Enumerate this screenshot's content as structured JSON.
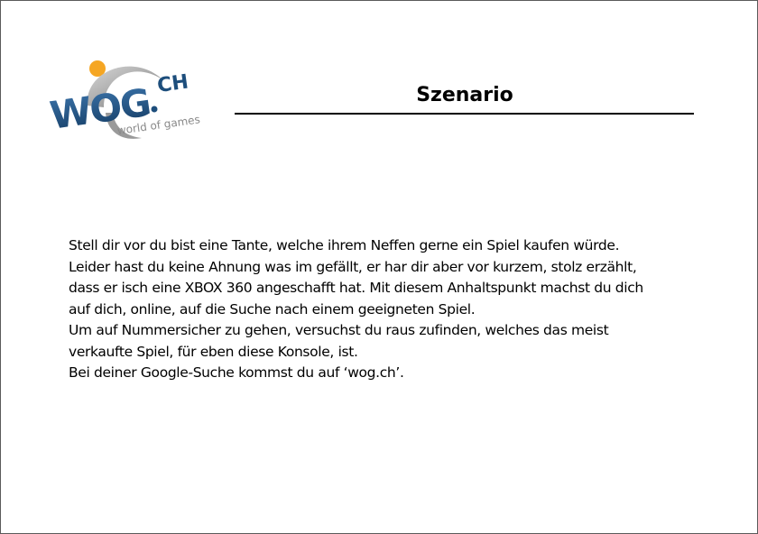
{
  "logo": {
    "primary_text": "WOG",
    "suffix_text": "CH",
    "tagline": "world of games",
    "colors": {
      "blue": "#1d4e7c",
      "gray": "#8a8a8a",
      "orange": "#f5a623"
    }
  },
  "slide": {
    "title": "Szenario",
    "lines": [
      "Stell dir vor du bist eine Tante, welche ihrem Neffen gerne ein Spiel kaufen würde.",
      "Leider hast du keine Ahnung was im gefällt, er har dir aber vor kurzem, stolz erzählt,",
      "dass er isch eine XBOX 360 angeschafft hat. Mit diesem Anhaltspunkt machst du dich",
      "auf dich, online, auf die Suche nach einem geeigneten Spiel.",
      "Um auf Nummersicher zu gehen, versuchst du raus zufinden, welches das meist",
      "verkaufte Spiel, für eben diese Konsole, ist.",
      "Bei deiner Google-Suche kommst du auf ‘wog.ch’."
    ]
  }
}
